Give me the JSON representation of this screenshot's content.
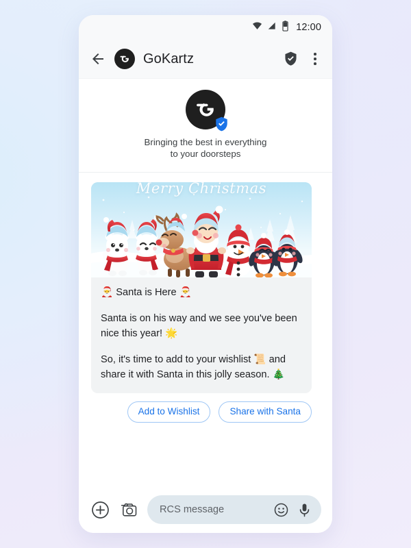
{
  "status_bar": {
    "time": "12:00",
    "icons": [
      "wifi-icon",
      "signal-icon",
      "battery-icon"
    ]
  },
  "app_bar": {
    "back_icon": "back-arrow-icon",
    "avatar_icon": "gokartz-logo-icon",
    "title": "GoKartz",
    "verified_icon": "verified-shield-icon",
    "overflow_icon": "more-vert-icon"
  },
  "brand_intro": {
    "avatar_icon": "gokartz-logo-icon",
    "verified_badge_icon": "verified-badge-icon",
    "tagline_line1": "Bringing the best in everything",
    "tagline_line2": "to your doorsteps"
  },
  "message_card": {
    "hero_title": "Merry Christmas",
    "hero_alt": "christmas-illustration",
    "heading": "🎅 Santa is Here 🎅",
    "paragraph1": "Santa is on his way and we see you've been nice this year! 🌟",
    "paragraph2": "So, it's time to add to your wishlist 📜 and share it with Santa in this jolly season. 🎄"
  },
  "suggestions": [
    {
      "label": "Add to Wishlist"
    },
    {
      "label": "Share with Santa"
    }
  ],
  "composer": {
    "plus_icon": "add-plus-icon",
    "camera_icon": "camera-icon",
    "placeholder": "RCS message",
    "emoji_icon": "emoji-smiley-icon",
    "mic_icon": "microphone-icon"
  },
  "colors": {
    "accent_blue": "#1a73e8",
    "chip_border": "#9ec6f5",
    "card_bg": "#f1f3f4",
    "appbar_bg": "#f8f9fa",
    "field_bg": "#dfe8ee",
    "logo_dark": "#1f1f1f",
    "badge_blue": "#1a73e8",
    "text_primary": "#202124",
    "text_secondary": "#5f6368"
  }
}
